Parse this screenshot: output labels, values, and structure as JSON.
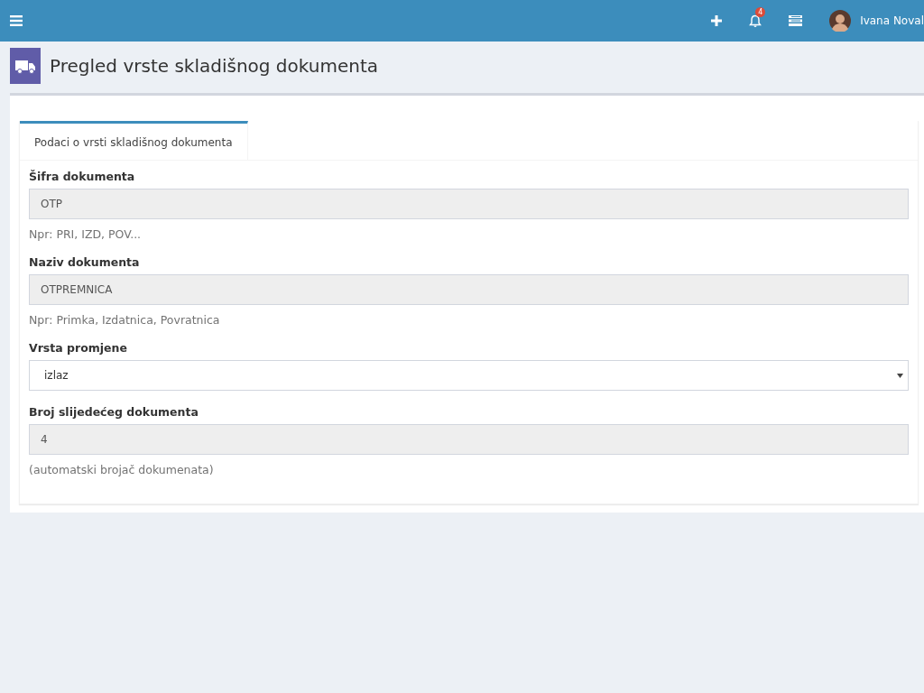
{
  "topbar": {
    "notifications_count": "4",
    "user_name": "Ivana Noval"
  },
  "page_title": "Pregled vrste skladišnog dokumenta",
  "tabs": [
    {
      "label": "Podaci o vrsti skladišnog dokumenta",
      "selected": true
    }
  ],
  "fields": [
    {
      "kind": "readonly",
      "label": "Šifra dokumenta",
      "value": "OTP",
      "help": "Npr: PRI, IZD, POV..."
    },
    {
      "kind": "readonly",
      "label": "Naziv dokumenta",
      "value": "OTPREMNICA",
      "help": "Npr: Primka, Izdatnica, Povratnica"
    },
    {
      "kind": "select",
      "label": "Vrsta promjene",
      "value": "izlaz"
    },
    {
      "kind": "readonly",
      "label": "Broj slijedećeg dokumenta",
      "value": "4",
      "help": "(automatski brojač dokumenata)"
    }
  ]
}
